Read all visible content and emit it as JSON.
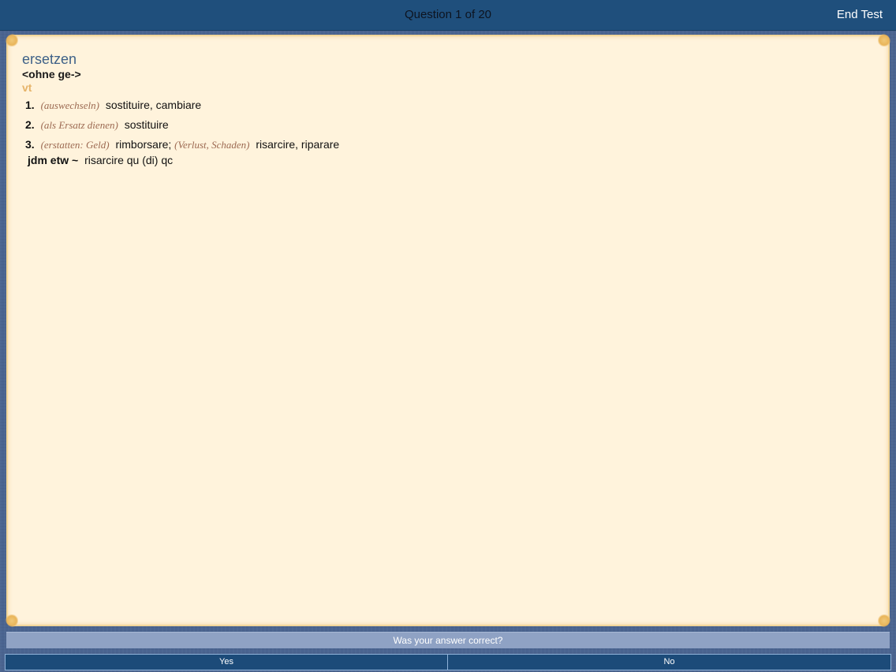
{
  "header": {
    "title": "Question 1 of 20",
    "end_test_label": "End Test"
  },
  "entry": {
    "headword": "ersetzen",
    "grammar": "<ohne ge->",
    "part_of_speech": "vt",
    "senses": [
      {
        "number": "1.",
        "context": "(auswechseln)",
        "translation": "sostituire, cambiare"
      },
      {
        "number": "2.",
        "context": "(als Ersatz dienen)",
        "translation": "sostituire"
      },
      {
        "number": "3.",
        "context": "(erstatten: Geld)",
        "translation": "rimborsare;",
        "context2": "(Verlust, Schaden)",
        "translation2": "risarcire, riparare"
      }
    ],
    "phrase": {
      "source": "jdm etw ~",
      "translation": "risarcire qu (di) qc"
    }
  },
  "prompt": {
    "question": "Was your answer correct?",
    "yes_label": "Yes",
    "no_label": "No"
  },
  "colors": {
    "header_bg": "#1f4f7c",
    "card_bg": "#fff3dc",
    "headword": "#3f6188",
    "pos": "#e6b46a",
    "context": "#9c6a52",
    "button_bg": "#1c4b79"
  }
}
